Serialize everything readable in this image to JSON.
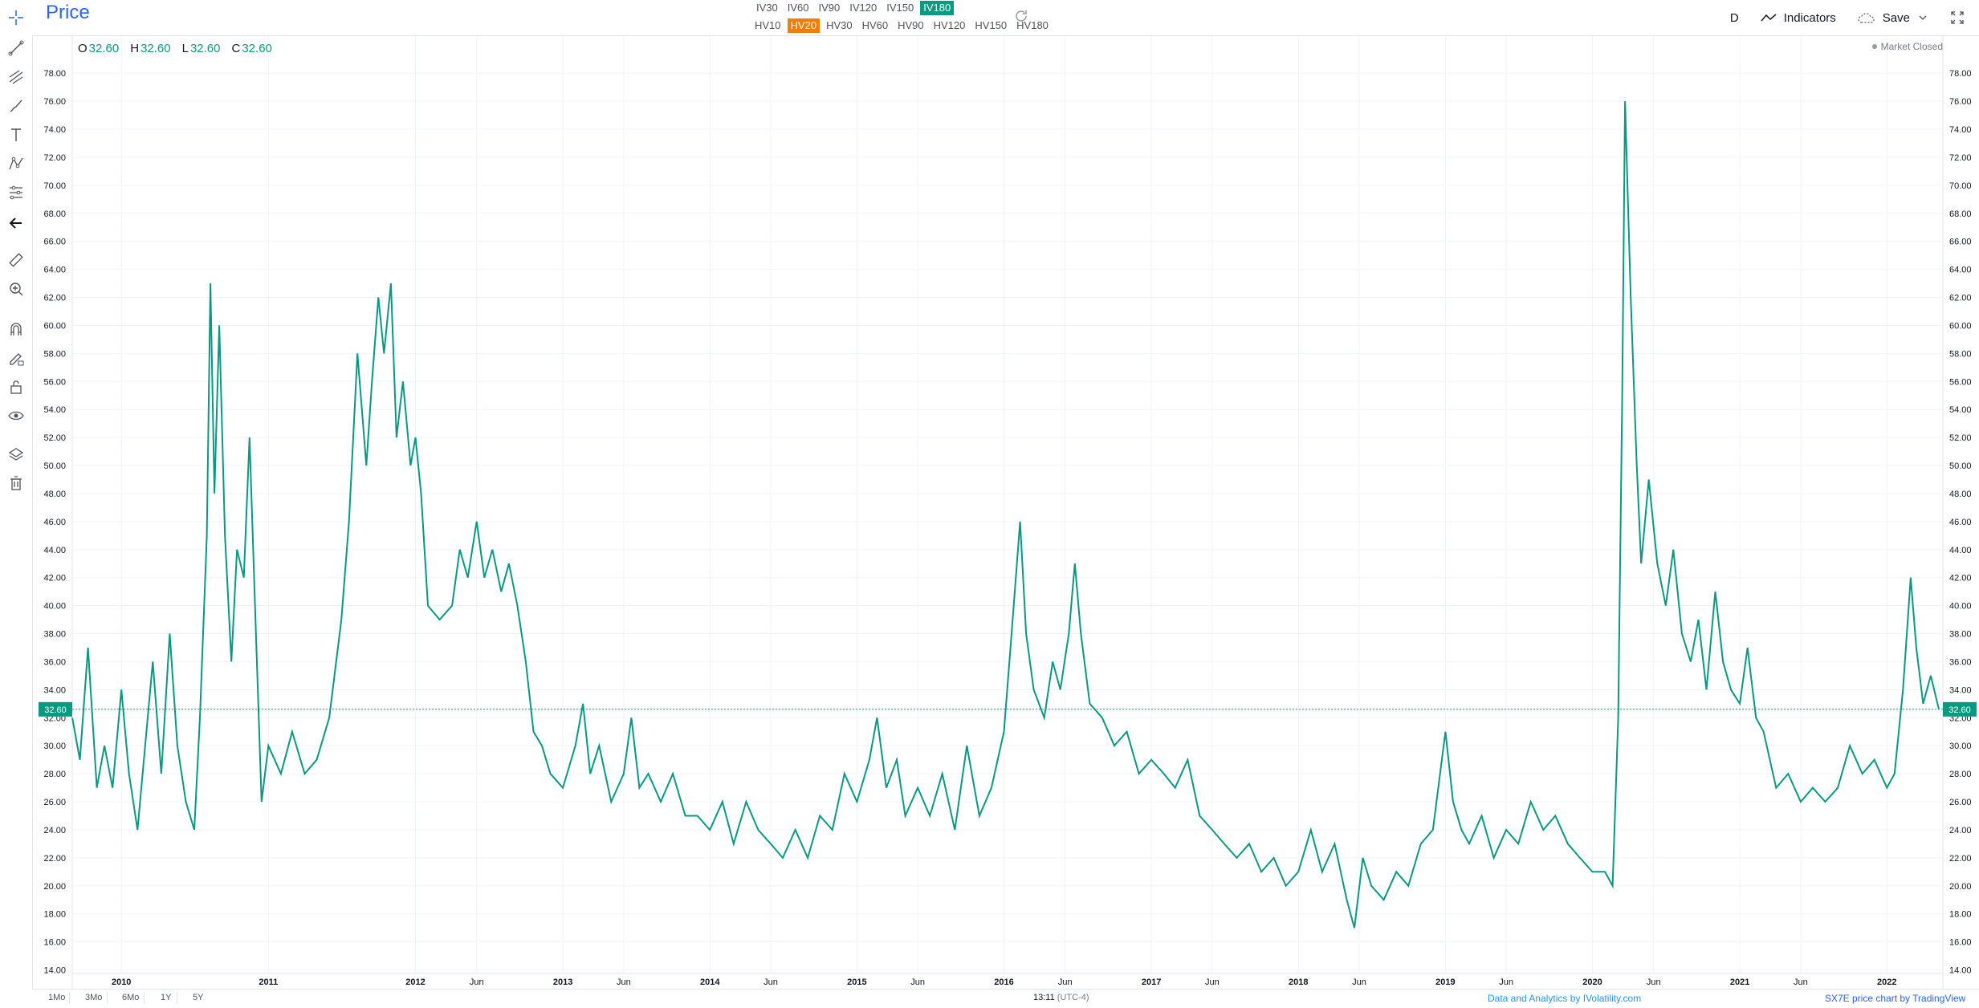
{
  "header": {
    "title": "Price",
    "iv_buttons": [
      "IV30",
      "IV60",
      "IV90",
      "IV120",
      "IV150",
      "IV180"
    ],
    "iv_active": "IV180",
    "hv_buttons": [
      "HV10",
      "HV20",
      "HV30",
      "HV60",
      "HV90",
      "HV120",
      "HV150",
      "HV180"
    ],
    "hv_active": "HV20",
    "interval": "D",
    "indicators_label": "Indicators",
    "save_label": "Save"
  },
  "ohlc": {
    "o_label": "O",
    "o_value": "32.60",
    "h_label": "H",
    "h_value": "32.60",
    "l_label": "L",
    "l_value": "32.60",
    "c_label": "C",
    "c_value": "32.60"
  },
  "status": {
    "market": "Market Closed"
  },
  "left_toolbar": [
    "crosshair-icon",
    "trend-line-icon",
    "fib-icon",
    "brush-icon",
    "text-icon",
    "pattern-icon",
    "measure-tools-icon",
    "back-arrow-icon",
    "ruler-icon",
    "zoom-in-icon",
    "magnet-icon",
    "lock-drawing-icon",
    "lock-icon",
    "eye-icon",
    "layers-icon",
    "trash-icon"
  ],
  "bottom": {
    "ranges": [
      "1Mo",
      "3Mo",
      "6Mo",
      "1Y",
      "5Y"
    ],
    "time": "13:11",
    "timezone": "(UTC-4)",
    "credit_left": "Data and Analytics by IVolatility.com",
    "credit_right": "SX7E price chart by TradingView"
  },
  "colors": {
    "line": "#089981",
    "accent": "#2962ff",
    "hv_active": "#f57c00",
    "iv_active": "#089981"
  },
  "chart_data": {
    "type": "line",
    "series": [
      {
        "points": [
          [
            "2009-09-01",
            32
          ],
          [
            "2009-09-20",
            29
          ],
          [
            "2009-10-10",
            37
          ],
          [
            "2009-11-01",
            27
          ],
          [
            "2009-11-20",
            30
          ],
          [
            "2009-12-10",
            27
          ],
          [
            "2010-01-01",
            34
          ],
          [
            "2010-01-20",
            28
          ],
          [
            "2010-02-10",
            24
          ],
          [
            "2010-03-01",
            30
          ],
          [
            "2010-03-20",
            36
          ],
          [
            "2010-04-10",
            28
          ],
          [
            "2010-05-01",
            38
          ],
          [
            "2010-05-20",
            30
          ],
          [
            "2010-06-10",
            26
          ],
          [
            "2010-07-01",
            24
          ],
          [
            "2010-07-15",
            32
          ],
          [
            "2010-08-01",
            45
          ],
          [
            "2010-08-10",
            63
          ],
          [
            "2010-08-20",
            48
          ],
          [
            "2010-09-01",
            60
          ],
          [
            "2010-09-15",
            45
          ],
          [
            "2010-10-01",
            36
          ],
          [
            "2010-10-15",
            44
          ],
          [
            "2010-11-01",
            42
          ],
          [
            "2010-11-15",
            52
          ],
          [
            "2010-12-01",
            38
          ],
          [
            "2010-12-15",
            26
          ],
          [
            "2011-01-01",
            30
          ],
          [
            "2011-02-01",
            28
          ],
          [
            "2011-03-01",
            31
          ],
          [
            "2011-04-01",
            28
          ],
          [
            "2011-05-01",
            29
          ],
          [
            "2011-06-01",
            32
          ],
          [
            "2011-07-01",
            39
          ],
          [
            "2011-07-20",
            46
          ],
          [
            "2011-08-10",
            58
          ],
          [
            "2011-09-01",
            50
          ],
          [
            "2011-09-15",
            56
          ],
          [
            "2011-10-01",
            62
          ],
          [
            "2011-10-15",
            58
          ],
          [
            "2011-11-01",
            63
          ],
          [
            "2011-11-15",
            52
          ],
          [
            "2011-12-01",
            56
          ],
          [
            "2011-12-20",
            50
          ],
          [
            "2012-01-01",
            52
          ],
          [
            "2012-01-15",
            48
          ],
          [
            "2012-02-01",
            40
          ],
          [
            "2012-03-01",
            39
          ],
          [
            "2012-04-01",
            40
          ],
          [
            "2012-04-20",
            44
          ],
          [
            "2012-05-10",
            42
          ],
          [
            "2012-06-01",
            46
          ],
          [
            "2012-06-20",
            42
          ],
          [
            "2012-07-10",
            44
          ],
          [
            "2012-08-01",
            41
          ],
          [
            "2012-08-20",
            43
          ],
          [
            "2012-09-10",
            40
          ],
          [
            "2012-10-01",
            36
          ],
          [
            "2012-10-20",
            31
          ],
          [
            "2012-11-10",
            30
          ],
          [
            "2012-12-01",
            28
          ],
          [
            "2013-01-01",
            27
          ],
          [
            "2013-02-01",
            30
          ],
          [
            "2013-02-20",
            33
          ],
          [
            "2013-03-10",
            28
          ],
          [
            "2013-04-01",
            30
          ],
          [
            "2013-05-01",
            26
          ],
          [
            "2013-06-01",
            28
          ],
          [
            "2013-06-20",
            32
          ],
          [
            "2013-07-10",
            27
          ],
          [
            "2013-08-01",
            28
          ],
          [
            "2013-09-01",
            26
          ],
          [
            "2013-10-01",
            28
          ],
          [
            "2013-11-01",
            25
          ],
          [
            "2013-12-01",
            25
          ],
          [
            "2014-01-01",
            24
          ],
          [
            "2014-02-01",
            26
          ],
          [
            "2014-03-01",
            23
          ],
          [
            "2014-04-01",
            26
          ],
          [
            "2014-05-01",
            24
          ],
          [
            "2014-06-01",
            23
          ],
          [
            "2014-07-01",
            22
          ],
          [
            "2014-08-01",
            24
          ],
          [
            "2014-09-01",
            22
          ],
          [
            "2014-10-01",
            25
          ],
          [
            "2014-11-01",
            24
          ],
          [
            "2014-12-01",
            28
          ],
          [
            "2015-01-01",
            26
          ],
          [
            "2015-02-01",
            29
          ],
          [
            "2015-02-20",
            32
          ],
          [
            "2015-03-15",
            27
          ],
          [
            "2015-04-10",
            29
          ],
          [
            "2015-05-01",
            25
          ],
          [
            "2015-06-01",
            27
          ],
          [
            "2015-07-01",
            25
          ],
          [
            "2015-08-01",
            28
          ],
          [
            "2015-09-01",
            24
          ],
          [
            "2015-10-01",
            30
          ],
          [
            "2015-11-01",
            25
          ],
          [
            "2015-12-01",
            27
          ],
          [
            "2016-01-01",
            31
          ],
          [
            "2016-01-20",
            38
          ],
          [
            "2016-02-10",
            46
          ],
          [
            "2016-02-25",
            38
          ],
          [
            "2016-03-15",
            34
          ],
          [
            "2016-04-10",
            32
          ],
          [
            "2016-05-01",
            36
          ],
          [
            "2016-05-20",
            34
          ],
          [
            "2016-06-10",
            38
          ],
          [
            "2016-06-25",
            43
          ],
          [
            "2016-07-10",
            38
          ],
          [
            "2016-08-01",
            33
          ],
          [
            "2016-09-01",
            32
          ],
          [
            "2016-10-01",
            30
          ],
          [
            "2016-11-01",
            31
          ],
          [
            "2016-12-01",
            28
          ],
          [
            "2017-01-01",
            29
          ],
          [
            "2017-02-01",
            28
          ],
          [
            "2017-03-01",
            27
          ],
          [
            "2017-04-01",
            29
          ],
          [
            "2017-05-01",
            25
          ],
          [
            "2017-06-01",
            24
          ],
          [
            "2017-07-01",
            23
          ],
          [
            "2017-08-01",
            22
          ],
          [
            "2017-09-01",
            23
          ],
          [
            "2017-10-01",
            21
          ],
          [
            "2017-11-01",
            22
          ],
          [
            "2017-12-01",
            20
          ],
          [
            "2018-01-01",
            21
          ],
          [
            "2018-02-01",
            24
          ],
          [
            "2018-03-01",
            21
          ],
          [
            "2018-04-01",
            23
          ],
          [
            "2018-05-01",
            19
          ],
          [
            "2018-05-20",
            17
          ],
          [
            "2018-06-10",
            22
          ],
          [
            "2018-07-01",
            20
          ],
          [
            "2018-08-01",
            19
          ],
          [
            "2018-09-01",
            21
          ],
          [
            "2018-10-01",
            20
          ],
          [
            "2018-11-01",
            23
          ],
          [
            "2018-12-01",
            24
          ],
          [
            "2019-01-01",
            31
          ],
          [
            "2019-01-20",
            26
          ],
          [
            "2019-02-10",
            24
          ],
          [
            "2019-03-01",
            23
          ],
          [
            "2019-04-01",
            25
          ],
          [
            "2019-05-01",
            22
          ],
          [
            "2019-06-01",
            24
          ],
          [
            "2019-07-01",
            23
          ],
          [
            "2019-08-01",
            26
          ],
          [
            "2019-09-01",
            24
          ],
          [
            "2019-10-01",
            25
          ],
          [
            "2019-11-01",
            23
          ],
          [
            "2019-12-01",
            22
          ],
          [
            "2020-01-01",
            21
          ],
          [
            "2020-02-01",
            21
          ],
          [
            "2020-02-20",
            20
          ],
          [
            "2020-03-05",
            32
          ],
          [
            "2020-03-15",
            55
          ],
          [
            "2020-03-22",
            76
          ],
          [
            "2020-04-05",
            62
          ],
          [
            "2020-04-20",
            50
          ],
          [
            "2020-05-01",
            43
          ],
          [
            "2020-05-20",
            49
          ],
          [
            "2020-06-10",
            43
          ],
          [
            "2020-07-01",
            40
          ],
          [
            "2020-07-20",
            44
          ],
          [
            "2020-08-10",
            38
          ],
          [
            "2020-09-01",
            36
          ],
          [
            "2020-09-20",
            39
          ],
          [
            "2020-10-10",
            34
          ],
          [
            "2020-11-01",
            41
          ],
          [
            "2020-11-20",
            36
          ],
          [
            "2020-12-10",
            34
          ],
          [
            "2021-01-01",
            33
          ],
          [
            "2021-01-20",
            37
          ],
          [
            "2021-02-10",
            32
          ],
          [
            "2021-03-01",
            31
          ],
          [
            "2021-04-01",
            27
          ],
          [
            "2021-05-01",
            28
          ],
          [
            "2021-06-01",
            26
          ],
          [
            "2021-07-01",
            27
          ],
          [
            "2021-08-01",
            26
          ],
          [
            "2021-09-01",
            27
          ],
          [
            "2021-10-01",
            30
          ],
          [
            "2021-11-01",
            28
          ],
          [
            "2021-12-01",
            29
          ],
          [
            "2022-01-01",
            27
          ],
          [
            "2022-01-20",
            28
          ],
          [
            "2022-02-10",
            34
          ],
          [
            "2022-03-01",
            42
          ],
          [
            "2022-03-15",
            37
          ],
          [
            "2022-04-01",
            33
          ],
          [
            "2022-04-20",
            35
          ],
          [
            "2022-05-10",
            32.6
          ]
        ]
      }
    ],
    "x_tick_labels": [
      "2010",
      "2011",
      "2012",
      "Jun",
      "2013",
      "Jun",
      "2014",
      "Jun",
      "2015",
      "Jun",
      "2016",
      "Jun",
      "2017",
      "Jun",
      "2018",
      "Jun",
      "2019",
      "Jun",
      "2020",
      "Jun",
      "2021",
      "Jun",
      "2022"
    ],
    "x_tick_dates": [
      "2010-01-01",
      "2011-01-01",
      "2012-01-01",
      "2012-06-01",
      "2013-01-01",
      "2013-06-01",
      "2014-01-01",
      "2014-06-01",
      "2015-01-01",
      "2015-06-01",
      "2016-01-01",
      "2016-06-01",
      "2017-01-01",
      "2017-06-01",
      "2018-01-01",
      "2018-06-01",
      "2019-01-01",
      "2019-06-01",
      "2020-01-01",
      "2020-06-01",
      "2021-01-01",
      "2021-06-01",
      "2022-01-01"
    ],
    "xlim": [
      "2009-09-01",
      "2022-05-20"
    ],
    "ylim": [
      13.0,
      79.5
    ],
    "y_ticks": [
      14,
      16,
      18,
      20,
      22,
      24,
      26,
      28,
      30,
      32,
      34,
      36,
      38,
      40,
      42,
      44,
      46,
      48,
      50,
      52,
      54,
      56,
      58,
      60,
      62,
      64,
      66,
      68,
      70,
      72,
      74,
      76,
      78
    ],
    "last_value": "32.60",
    "grid": true
  }
}
